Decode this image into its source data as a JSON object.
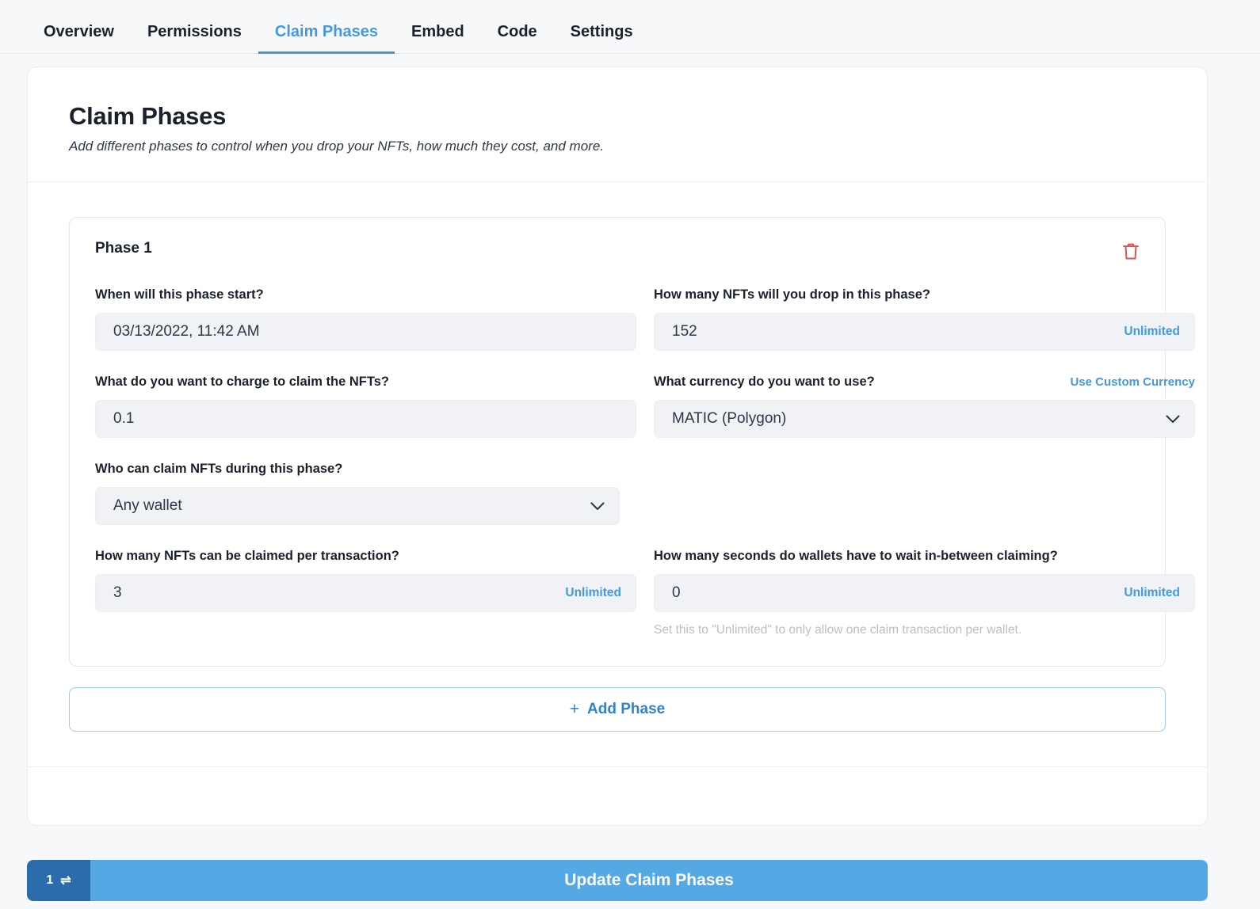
{
  "tabs": [
    {
      "label": "Overview",
      "active": false
    },
    {
      "label": "Permissions",
      "active": false
    },
    {
      "label": "Claim Phases",
      "active": true
    },
    {
      "label": "Embed",
      "active": false
    },
    {
      "label": "Code",
      "active": false
    },
    {
      "label": "Settings",
      "active": false
    }
  ],
  "header": {
    "title": "Claim Phases",
    "subtitle": "Add different phases to control when you drop your NFTs, how much they cost, and more."
  },
  "phase": {
    "title": "Phase 1",
    "delete_icon": "trash-icon",
    "fields": {
      "start": {
        "label": "When will this phase start?",
        "value": "03/13/2022, 11:42 AM"
      },
      "supply": {
        "label": "How many NFTs will you drop in this phase?",
        "value": "152",
        "suffix": "Unlimited"
      },
      "price": {
        "label": "What do you want to charge to claim the NFTs?",
        "value": "0.1"
      },
      "currency": {
        "label": "What currency do you want to use?",
        "action": "Use Custom Currency",
        "value": "MATIC (Polygon)",
        "icon": "chevron-down-icon"
      },
      "who": {
        "label": "Who can claim NFTs during this phase?",
        "value": "Any wallet",
        "icon": "chevron-down-icon"
      },
      "per_transaction": {
        "label": "How many NFTs can be claimed per transaction?",
        "value": "3",
        "suffix": "Unlimited"
      },
      "wait_seconds": {
        "label": "How many seconds do wallets have to wait in-between claiming?",
        "value": "0",
        "suffix": "Unlimited",
        "hint": "Set this to \"Unlimited\" to only allow one claim transaction per wallet."
      }
    }
  },
  "add_phase": {
    "plus": "+",
    "label": "Add Phase"
  },
  "bottombar": {
    "count": "1",
    "swap_icon": "⇌",
    "update_label": "Update Claim Phases"
  },
  "colors": {
    "accent": "#4299e1",
    "button": "#54a8e4",
    "badge": "#2b6cab",
    "danger": "#e05252",
    "input_bg": "#f1f2f6",
    "page_bg": "#f7f8f9"
  }
}
